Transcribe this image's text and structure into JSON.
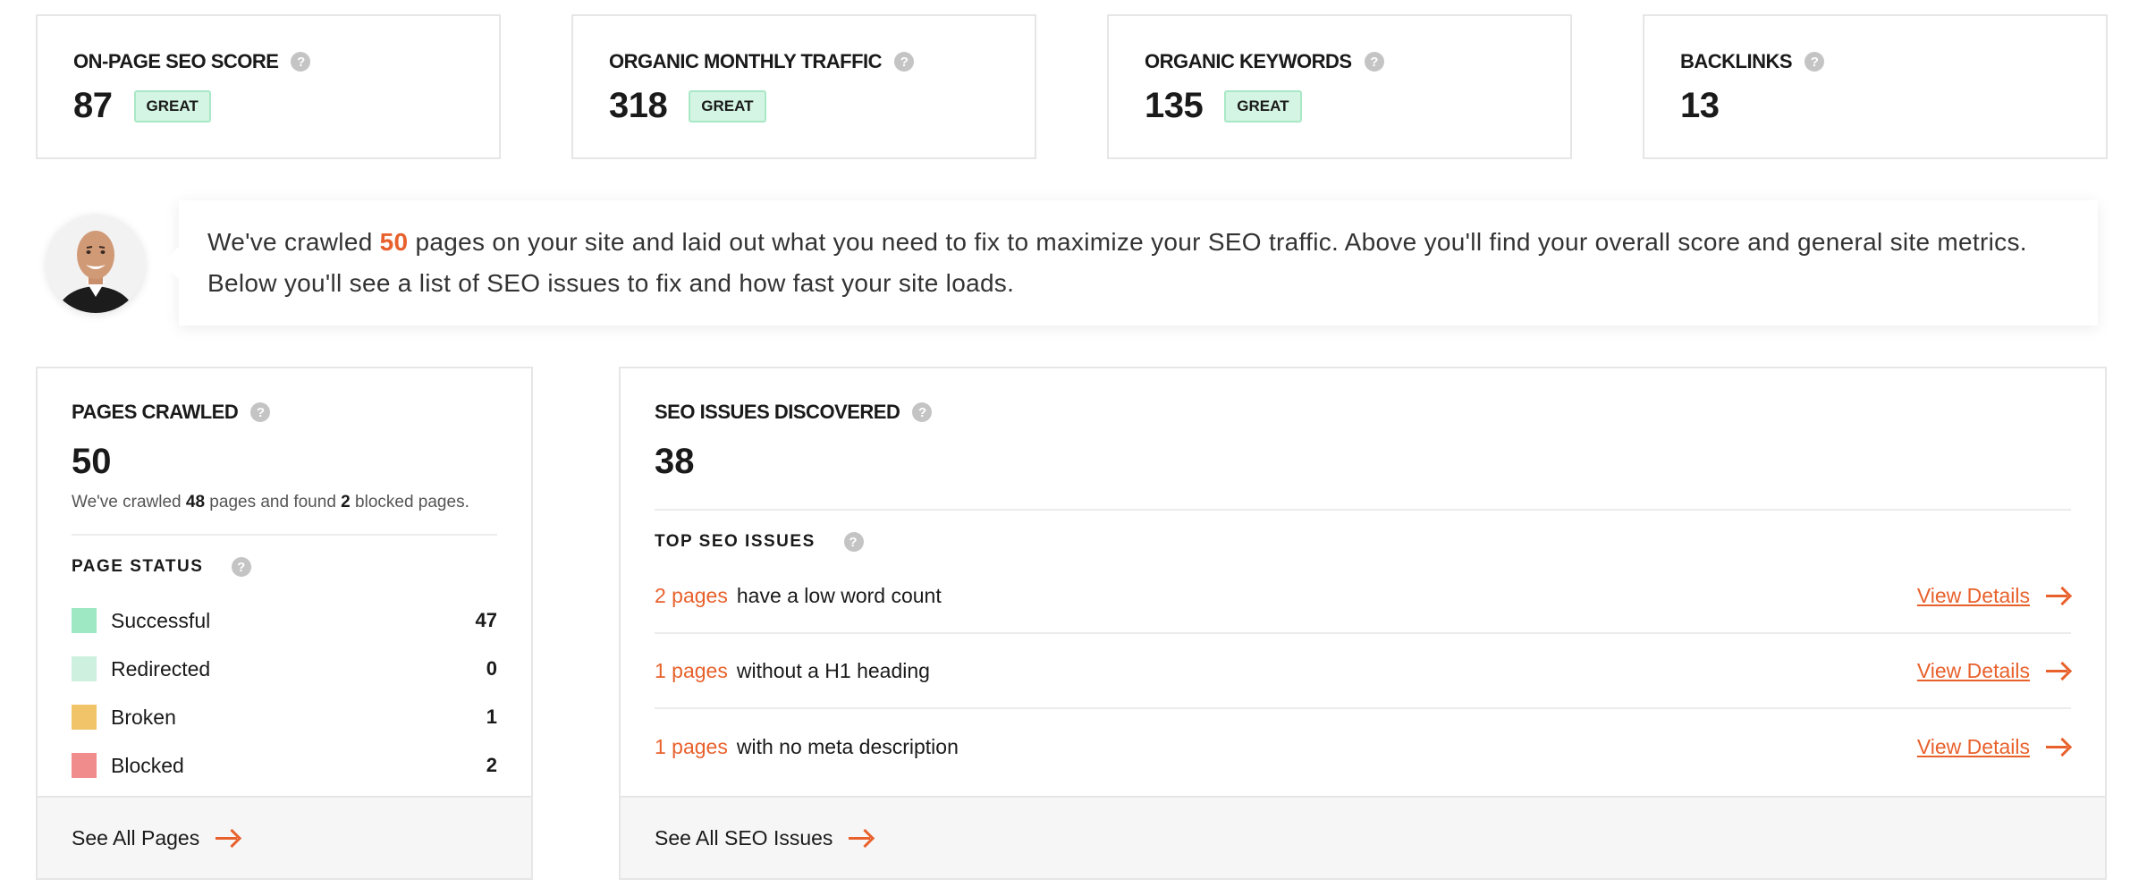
{
  "metrics": [
    {
      "label": "ON-PAGE SEO SCORE",
      "value": "87",
      "badge": "GREAT"
    },
    {
      "label": "ORGANIC MONTHLY TRAFFIC",
      "value": "318",
      "badge": "GREAT"
    },
    {
      "label": "ORGANIC KEYWORDS",
      "value": "135",
      "badge": "GREAT"
    },
    {
      "label": "BACKLINKS",
      "value": "13",
      "badge": ""
    }
  ],
  "message": {
    "prefix": "We've crawled ",
    "highlight": "50",
    "suffix": " pages on your site and laid out what you need to fix to maximize your SEO traffic. Above you'll find your overall score and general site metrics. Below you'll see a list of SEO issues to fix and how fast your site loads."
  },
  "pages_crawled": {
    "title": "PAGES CRAWLED",
    "value": "50",
    "sub_prefix": "We've crawled ",
    "sub_crawled": "48",
    "sub_middle": " pages and found ",
    "sub_blocked": "2",
    "sub_suffix": " blocked pages.",
    "status_title": "PAGE STATUS",
    "statuses": [
      {
        "name": "Successful",
        "count": "47",
        "color": "#9ee8c4"
      },
      {
        "name": "Redirected",
        "count": "0",
        "color": "#cdf0df"
      },
      {
        "name": "Broken",
        "count": "1",
        "color": "#f2c46a"
      },
      {
        "name": "Blocked",
        "count": "2",
        "color": "#f08c8c"
      }
    ],
    "footer": "See All Pages"
  },
  "seo_issues": {
    "title": "SEO ISSUES DISCOVERED",
    "value": "38",
    "top_title": "TOP SEO ISSUES",
    "issues": [
      {
        "count": "2 pages",
        "desc": "have a low word count",
        "link": "View Details"
      },
      {
        "count": "1 pages",
        "desc": "without a H1 heading",
        "link": "View Details"
      },
      {
        "count": "1 pages",
        "desc": "with no meta description",
        "link": "View Details"
      }
    ],
    "footer": "See All SEO Issues"
  },
  "icons": {
    "help": "?"
  },
  "colors": {
    "accent": "#e8612c",
    "badge_bg": "#d4f5e4"
  }
}
